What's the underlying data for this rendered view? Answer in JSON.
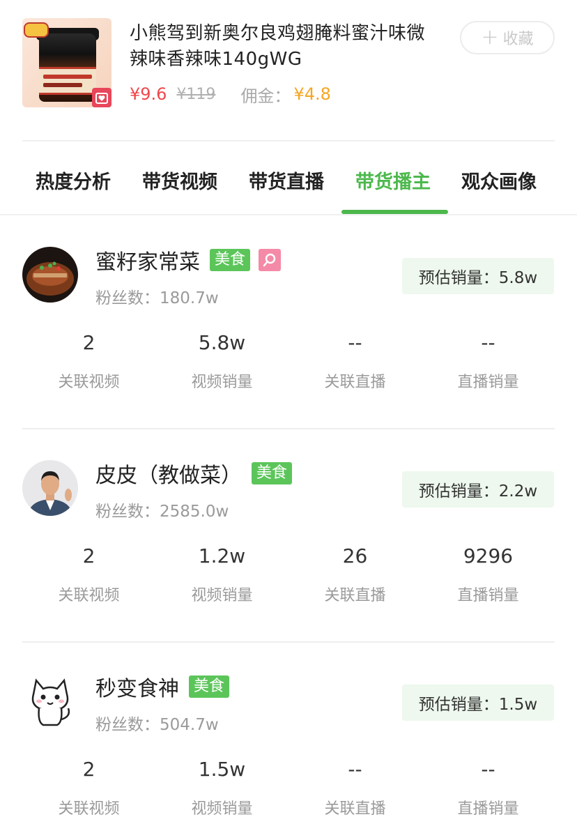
{
  "product": {
    "title": "小熊驾到新奥尔良鸡翅腌料蜜汁味微辣味香辣味140gWG",
    "price": "¥9.6",
    "original_price": "¥119",
    "commission_label": "佣金：",
    "commission_value": "¥4.8",
    "favorite_label": "收藏"
  },
  "tabs": [
    {
      "label": "热度分析",
      "active": false
    },
    {
      "label": "带货视频",
      "active": false
    },
    {
      "label": "带货直播",
      "active": false
    },
    {
      "label": "带货播主",
      "active": true
    },
    {
      "label": "观众画像",
      "active": false
    }
  ],
  "streamers": [
    {
      "name": "蜜籽家常菜",
      "tag": "美食",
      "has_extra_icon": true,
      "fans": "粉丝数：180.7w",
      "estimated_sales": "预估销量：5.8w",
      "stats": [
        {
          "value": "2",
          "label": "关联视频"
        },
        {
          "value": "5.8w",
          "label": "视频销量"
        },
        {
          "value": "--",
          "label": "关联直播"
        },
        {
          "value": "--",
          "label": "直播销量"
        }
      ]
    },
    {
      "name": "皮皮（教做菜）",
      "tag": "美食",
      "has_extra_icon": false,
      "fans": "粉丝数：2585.0w",
      "estimated_sales": "预估销量：2.2w",
      "stats": [
        {
          "value": "2",
          "label": "关联视频"
        },
        {
          "value": "1.2w",
          "label": "视频销量"
        },
        {
          "value": "26",
          "label": "关联直播"
        },
        {
          "value": "9296",
          "label": "直播销量"
        }
      ]
    },
    {
      "name": "秒变食神",
      "tag": "美食",
      "has_extra_icon": false,
      "fans": "粉丝数：504.7w",
      "estimated_sales": "预估销量：1.5w",
      "stats": [
        {
          "value": "2",
          "label": "关联视频"
        },
        {
          "value": "1.5w",
          "label": "视频销量"
        },
        {
          "value": "--",
          "label": "关联直播"
        },
        {
          "value": "--",
          "label": "直播销量"
        }
      ]
    }
  ],
  "colors": {
    "accent_green": "#4cb84c",
    "price_red": "#f0474d",
    "commission_orange": "#f5a623",
    "tag_green": "#5cc55a",
    "estimate_bg": "#eef8ee"
  },
  "icons": [
    "product-image",
    "heart-badge-icon",
    "plus-icon",
    "search-badge-icon"
  ]
}
